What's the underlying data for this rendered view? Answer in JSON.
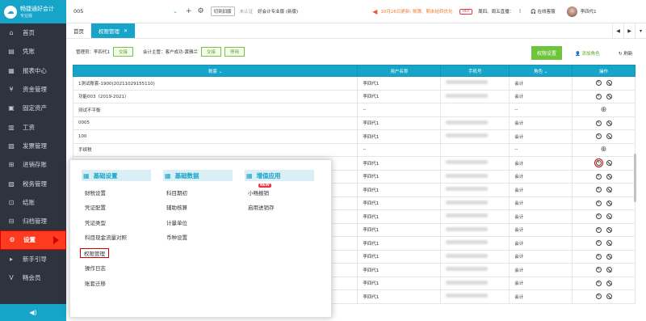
{
  "sidebar": {
    "logo": {
      "title": "畅捷通好会计",
      "sub": "专业版"
    },
    "items": [
      {
        "label": "首页",
        "icon": "home-icon",
        "glyph": "⌂"
      },
      {
        "label": "凭账",
        "icon": "voucher-icon",
        "glyph": "▤"
      },
      {
        "label": "报表中心",
        "icon": "report-icon",
        "glyph": "▦"
      },
      {
        "label": "资金管理",
        "icon": "fund-icon",
        "glyph": "¥"
      },
      {
        "label": "固定资产",
        "icon": "asset-icon",
        "glyph": "▣"
      },
      {
        "label": "工资",
        "icon": "salary-icon",
        "glyph": "▥"
      },
      {
        "label": "发票管理",
        "icon": "invoice-icon",
        "glyph": "▧"
      },
      {
        "label": "进销存账",
        "icon": "inventory-icon",
        "glyph": "⊞"
      },
      {
        "label": "税务管理",
        "icon": "tax-icon",
        "glyph": "▨"
      },
      {
        "label": "结账",
        "icon": "close-books-icon",
        "glyph": "⊡"
      },
      {
        "label": "归档管理",
        "icon": "archive-icon",
        "glyph": "⊟"
      },
      {
        "label": "设置",
        "icon": "settings-icon",
        "glyph": "⚙"
      },
      {
        "label": "新手引导",
        "icon": "guide-icon",
        "glyph": "▸"
      },
      {
        "label": "畅会员",
        "icon": "member-icon",
        "glyph": "V"
      }
    ],
    "footer_icon": "speaker-icon"
  },
  "topbar": {
    "account": "005",
    "switch_old": "切到旧版",
    "cert": "未认证",
    "edition": "好会计专业版 (新版)",
    "notice": "10月26日更新: 账簿、期末结转优化",
    "hot": "HOT",
    "live": "周四、周五直播：",
    "live_pipe": "|",
    "service": "在线客服",
    "user": "李四代1"
  },
  "tabs": [
    {
      "label": "首页"
    },
    {
      "label": "权限管理"
    }
  ],
  "mgrbar": {
    "admin_label": "管理员：李四代1",
    "admin_btn": "交接",
    "acct_label": "会计主管：客户成功-黄雅兰",
    "acct_btn": "交接",
    "acct_btn2": "停用",
    "perm_btn": "权限设置",
    "add_role": "添加角色",
    "refresh": "刷新"
  },
  "table": {
    "headers": [
      "账套",
      "用户名称",
      "手机号",
      "角色",
      "操作"
    ],
    "rows": [
      {
        "acct": "1测试账套-1900(20211029155110)",
        "user": "李四代1",
        "phone": true,
        "role": "会计",
        "ops": "edit"
      },
      {
        "acct": "功能003（2019-2021）",
        "user": "李四代1",
        "phone": true,
        "role": "会计",
        "ops": "edit"
      },
      {
        "acct": "测试不平衡",
        "user": "--",
        "phone": false,
        "role": "--",
        "ops": "add"
      },
      {
        "acct": "0005",
        "user": "李四代1",
        "phone": true,
        "role": "会计",
        "ops": "edit"
      },
      {
        "acct": "100",
        "user": "李四代1",
        "phone": true,
        "role": "会计",
        "ops": "edit"
      },
      {
        "acct": "手续税",
        "user": "--",
        "phone": false,
        "role": "--",
        "ops": "add"
      },
      {
        "acct": "",
        "user": "李四代1",
        "phone": true,
        "role": "会计",
        "ops": "edit-hl"
      },
      {
        "acct": "",
        "user": "李四代1",
        "phone": true,
        "role": "会计",
        "ops": "edit"
      },
      {
        "acct": "",
        "user": "李四代1",
        "phone": true,
        "role": "会计",
        "ops": "edit"
      },
      {
        "acct": "",
        "user": "李四代1",
        "phone": true,
        "role": "会计",
        "ops": "edit"
      },
      {
        "acct": "",
        "user": "李四代1",
        "phone": true,
        "role": "会计",
        "ops": "edit"
      },
      {
        "acct": "",
        "user": "李四代1",
        "phone": true,
        "role": "会计",
        "ops": "edit"
      },
      {
        "acct": "",
        "user": "李四代1",
        "phone": true,
        "role": "会计",
        "ops": "edit"
      },
      {
        "acct": "",
        "user": "李四代1",
        "phone": true,
        "role": "会计",
        "ops": "edit"
      },
      {
        "acct": "",
        "user": "李四代1",
        "phone": true,
        "role": "会计",
        "ops": "edit"
      },
      {
        "acct": "",
        "user": "李四代1",
        "phone": true,
        "role": "会计",
        "ops": "edit"
      },
      {
        "acct": "",
        "user": "李四代1",
        "phone": true,
        "role": "会计",
        "ops": "edit"
      }
    ]
  },
  "popup": {
    "base": {
      "title": "基础设置",
      "items": [
        "财税设置",
        "凭证配置",
        "凭证类型",
        "科目现金流量对照",
        "权限管理",
        "操作日志",
        "账套迁移"
      ]
    },
    "data": {
      "title": "基础数据",
      "items": [
        "科目期初",
        "辅助核算",
        "计量单位",
        "币种设置"
      ]
    },
    "value": {
      "title": "增值应用",
      "items": [
        "小畅报销",
        "启用进销存"
      ],
      "new_tag": "NEW"
    }
  }
}
